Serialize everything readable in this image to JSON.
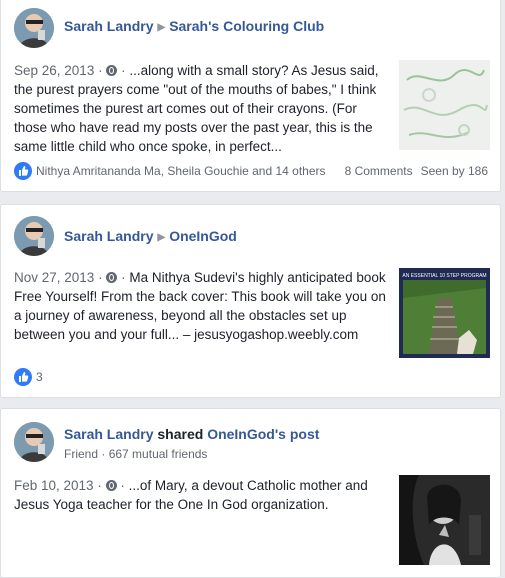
{
  "colors": {
    "link": "#365899",
    "like": "#2f7bf6",
    "meta": "#616770"
  },
  "posts": [
    {
      "author": "Sarah Landry",
      "target": "Sarah's Colouring Club",
      "date": "Sep 26, 2013",
      "dot": "·",
      "text": "...along with a small story? As Jesus said, the purest prayers come \"out of the mouths of babes,\" I think sometimes the purest art comes out of their crayons. (For those who have read my posts over the past year, this is the same little child who once spoke, in perfect...",
      "reactions": "Nithya Amritananda Ma, Sheila Gouchie and 14 others",
      "comments": "8 Comments",
      "seen": "Seen by 186"
    },
    {
      "author": "Sarah Landry",
      "target": "OneInGod",
      "date": "Nov 27, 2013",
      "dot": "·",
      "text": "Ma Nithya Sudevi's highly anticipated book Free Yourself! From the back cover: This book will take you on a journey of awareness, beyond all the obstacles set up between you and your full... – jesusyogashop.weebly.com",
      "reactions": "3",
      "thumb_caption": "AN ESSENTIAL 10 STEP PROGRAM"
    },
    {
      "author": "Sarah Landry",
      "shared": "shared",
      "target": "OneInGod's post",
      "friend_label": "Friend",
      "mutual": "667 mutual friends",
      "date": "Feb 10, 2013",
      "dot": "·",
      "text": "...of Mary, a devout Catholic mother and Jesus Yoga teacher for the One In God organization."
    }
  ]
}
